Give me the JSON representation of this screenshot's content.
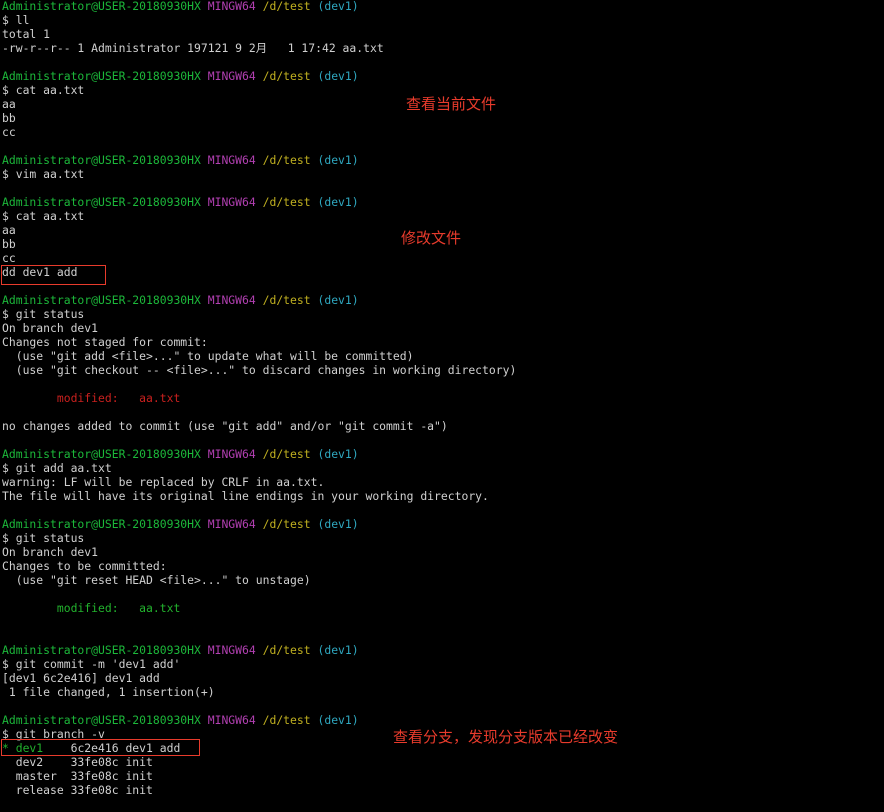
{
  "colors": {
    "user_host": "#1cb83a",
    "shell": "#b13fb1",
    "path": "#c0b020",
    "branch": "#2fa8c0",
    "text": "#d0d0d0",
    "modified_unstaged": "#c8201e",
    "modified_staged": "#22b22d",
    "annotation": "#e83b2c",
    "background": "#000000"
  },
  "prompt": {
    "user_host": "Administrator@USER-20180930HX",
    "shell": "MINGW64",
    "path": "/d/test",
    "branch": "(dev1)"
  },
  "lines": [
    {
      "type": "prompt"
    },
    {
      "type": "text",
      "text": "$ ll"
    },
    {
      "type": "text",
      "text": "total 1"
    },
    {
      "type": "text",
      "text": "-rw-r--r-- 1 Administrator 197121 9 2月   1 17:42 aa.txt"
    },
    {
      "type": "blank"
    },
    {
      "type": "prompt"
    },
    {
      "type": "text",
      "text": "$ cat aa.txt"
    },
    {
      "type": "text",
      "text": "aa"
    },
    {
      "type": "text",
      "text": "bb"
    },
    {
      "type": "text",
      "text": "cc"
    },
    {
      "type": "blank"
    },
    {
      "type": "prompt"
    },
    {
      "type": "text",
      "text": "$ vim aa.txt"
    },
    {
      "type": "blank"
    },
    {
      "type": "prompt"
    },
    {
      "type": "text",
      "text": "$ cat aa.txt"
    },
    {
      "type": "text",
      "text": "aa"
    },
    {
      "type": "text",
      "text": "bb"
    },
    {
      "type": "text",
      "text": "cc"
    },
    {
      "type": "text",
      "text": "dd dev1 add"
    },
    {
      "type": "blank"
    },
    {
      "type": "prompt"
    },
    {
      "type": "text",
      "text": "$ git status"
    },
    {
      "type": "text",
      "text": "On branch dev1"
    },
    {
      "type": "text",
      "text": "Changes not staged for commit:"
    },
    {
      "type": "text",
      "text": "  (use \"git add <file>...\" to update what will be committed)"
    },
    {
      "type": "text",
      "text": "  (use \"git checkout -- <file>...\" to discard changes in working directory)"
    },
    {
      "type": "blank"
    },
    {
      "type": "text",
      "style": "red",
      "text": "        modified:   aa.txt"
    },
    {
      "type": "blank"
    },
    {
      "type": "text",
      "text": "no changes added to commit (use \"git add\" and/or \"git commit -a\")"
    },
    {
      "type": "blank"
    },
    {
      "type": "prompt"
    },
    {
      "type": "text",
      "text": "$ git add aa.txt"
    },
    {
      "type": "text",
      "text": "warning: LF will be replaced by CRLF in aa.txt."
    },
    {
      "type": "text",
      "text": "The file will have its original line endings in your working directory."
    },
    {
      "type": "blank"
    },
    {
      "type": "prompt"
    },
    {
      "type": "text",
      "text": "$ git status"
    },
    {
      "type": "text",
      "text": "On branch dev1"
    },
    {
      "type": "text",
      "text": "Changes to be committed:"
    },
    {
      "type": "text",
      "text": "  (use \"git reset HEAD <file>...\" to unstage)"
    },
    {
      "type": "blank"
    },
    {
      "type": "text",
      "style": "green",
      "text": "        modified:   aa.txt"
    },
    {
      "type": "blank"
    },
    {
      "type": "blank"
    },
    {
      "type": "prompt"
    },
    {
      "type": "text",
      "text": "$ git commit -m 'dev1 add'"
    },
    {
      "type": "text",
      "text": "[dev1 6c2e416] dev1 add"
    },
    {
      "type": "text",
      "text": " 1 file changed, 1 insertion(+)"
    },
    {
      "type": "blank"
    },
    {
      "type": "prompt"
    },
    {
      "type": "text",
      "text": "$ git branch -v"
    },
    {
      "type": "branch",
      "current": true,
      "marker": "* ",
      "name": "dev1   ",
      "rest": " 6c2e416 dev1 add"
    },
    {
      "type": "text",
      "text": "  dev2    33fe08c init"
    },
    {
      "type": "text",
      "text": "  master  33fe08c init"
    },
    {
      "type": "text",
      "text": "  release 33fe08c init"
    }
  ],
  "annotations": [
    {
      "text": "查看当前文件"
    },
    {
      "text": "修改文件"
    },
    {
      "text": "查看分支，发现分支版本已经改变"
    }
  ]
}
